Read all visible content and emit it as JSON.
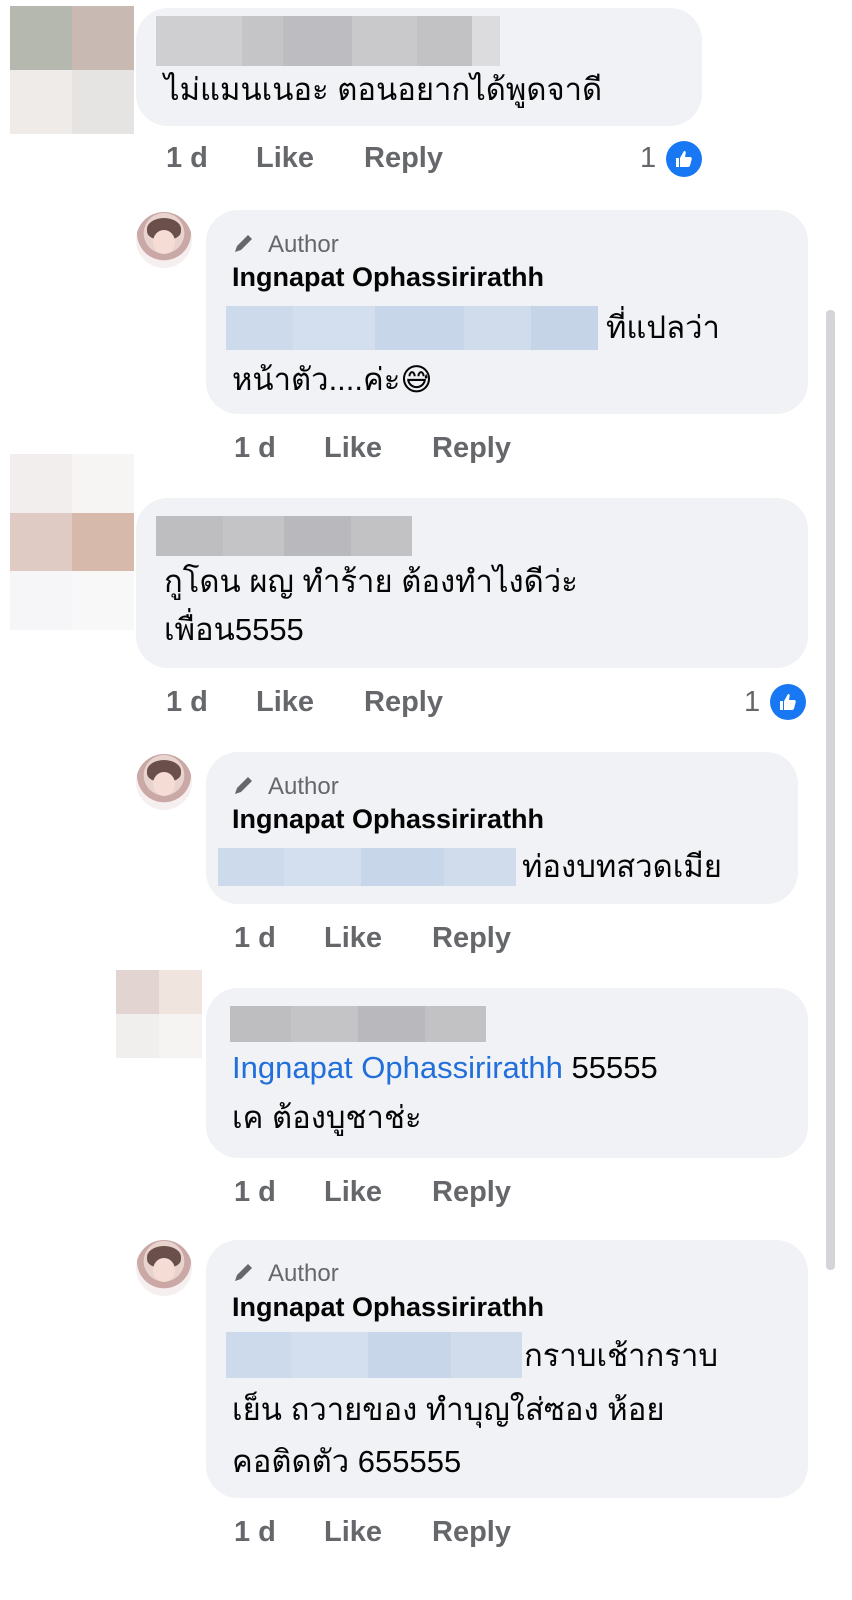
{
  "comments": [
    {
      "text_lines": [
        "ไม่แมนเนอะ ตอนอยากได้พูดจาดี"
      ],
      "time": "1 d",
      "like": "Like",
      "reply": "Reply",
      "reactions": "1"
    },
    {
      "author_tag": "Author",
      "author": "Ingnapat Ophassirirathh",
      "text_lines": [
        "ที่แปลว่า",
        "หน้าตัว....ค่ะ😅"
      ],
      "time": "1 d",
      "like": "Like",
      "reply": "Reply"
    },
    {
      "text_lines": [
        "กูโดน ผญ ทำร้าย ต้องทำไงดีว่ะ",
        "เพื่อน5555"
      ],
      "time": "1 d",
      "like": "Like",
      "reply": "Reply",
      "reactions": "1"
    },
    {
      "author_tag": "Author",
      "author": "Ingnapat Ophassirirathh",
      "text_lines": [
        "ท่องบทสวดเมีย"
      ],
      "time": "1 d",
      "like": "Like",
      "reply": "Reply"
    },
    {
      "mention": "Ingnapat Ophassirirathh",
      "text_lines": [
        "55555",
        "เค ต้องบูชาช่ะ"
      ],
      "time": "1 d",
      "like": "Like",
      "reply": "Reply"
    },
    {
      "author_tag": "Author",
      "author": "Ingnapat Ophassirirathh",
      "text_lines": [
        "กราบเช้ากราบ",
        "เย็น ถวายของ ทำบุญใส่ซอง ห้อย",
        "คอติดตัว 655555"
      ],
      "time": "1 d",
      "like": "Like",
      "reply": "Reply"
    }
  ],
  "colors": {
    "bubble": "#f0f2f5",
    "meta": "#65676b",
    "mention": "#216fdb",
    "like_blue": "#1877f2"
  },
  "icons": {
    "author": "pencil-icon",
    "reaction": "thumbs-up-icon"
  }
}
